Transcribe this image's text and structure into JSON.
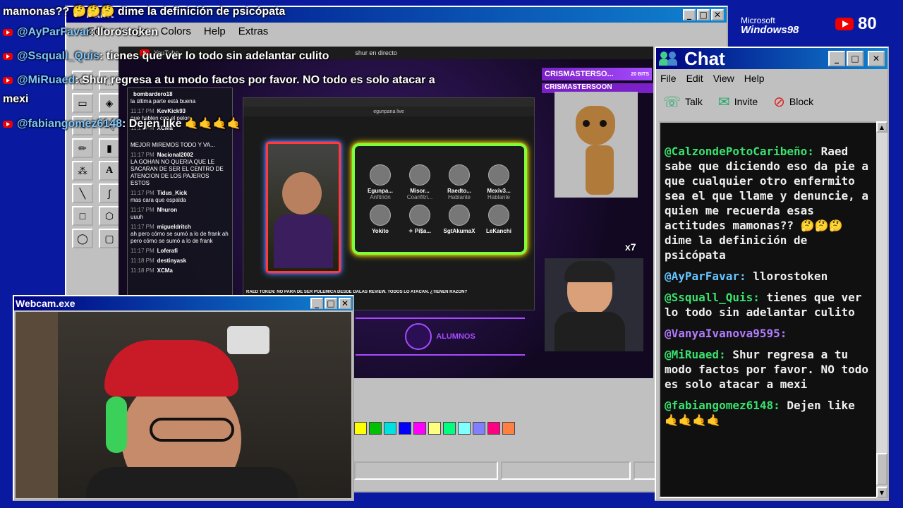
{
  "overlay": {
    "lines": [
      {
        "user": "",
        "text": "mamonas?? 🤔🤔🤔 dime la definición de psicópata"
      },
      {
        "user": "@AyParFavar",
        "text": "llorostoken"
      },
      {
        "user": "@Ssquall_Quis",
        "text": "tienes que ver lo todo sin adelantar culito"
      },
      {
        "user": "@MiRuaed",
        "text": "Shur regresa a tu modo factos por favor. NO todo es solo atacar a"
      },
      {
        "user": "",
        "text": "mexi"
      },
      {
        "user": "@fabiangomez6148",
        "text": "Dejen like 🤙🤙🤙🤙"
      }
    ],
    "yt_count": "80",
    "win_logo_top": "Microsoft",
    "win_logo_bottom": "Windows98"
  },
  "paint": {
    "title": "Paint",
    "menu": [
      "Edit",
      "Image",
      "Colors",
      "Help",
      "Extras"
    ],
    "palette": [
      "#ffff00",
      "#00c000",
      "#00e0e0",
      "#0000ff",
      "#ff00ff",
      "#ffff80",
      "#00ff80",
      "#80ffff",
      "#8080ff",
      "#ff0080",
      "#ff8040"
    ]
  },
  "browser": {
    "tab": "YouTube",
    "search": "shur en directo",
    "ticker": "RAED TOKEN: NO PARA DE SER POLEMICA DESDE DALAS REVIEW. TODOS LO ATACAN. ¿TIENEN RAZON?",
    "inner_search": "egunpana live",
    "side_user1": "CRISMASTERSO...",
    "side_user2": "CRISMASTERSOON",
    "bits": "20 BITS",
    "x7": "x7",
    "alumnos": "ALUMNOS",
    "guests": [
      {
        "name": "Egunpa...",
        "role": "Anfitrión"
      },
      {
        "name": "Misor...",
        "role": "Coanfitri..."
      },
      {
        "name": "Raedto...",
        "role": "Hablante"
      },
      {
        "name": "Mexiv3...",
        "role": "Hablante"
      },
      {
        "name": "Yokito",
        "role": ""
      },
      {
        "name": "✧ Pi$a...",
        "role": ""
      },
      {
        "name": "SgtAkumaX",
        "role": ""
      },
      {
        "name": "LeKanchi",
        "role": ""
      }
    ]
  },
  "side_chat": [
    {
      "time": "",
      "user": "bombardero18",
      "msg": "la última parte está buena"
    },
    {
      "time": "11:17 PM",
      "user": "KevKick93",
      "msg": "que hablen con el pelon"
    },
    {
      "time": "11:17 PM",
      "user": "XCMa",
      "msg": ""
    },
    {
      "time": "",
      "user": "",
      "msg": "MEJOR MIREMOS TODO Y VA..."
    },
    {
      "time": "11:17 PM",
      "user": "Nacional2002",
      "msg": "LA GOHAN NO QUERIA QUE LE SACARAN DE SER EL CENTRO DE ATENCION DE LOS PAJEROS ESTOS"
    },
    {
      "time": "11:17 PM",
      "user": "Tidus_Kick",
      "msg": "mas cara que espalda"
    },
    {
      "time": "11:17 PM",
      "user": "Nhuron",
      "msg": "uuuh"
    },
    {
      "time": "11:17 PM",
      "user": "migueldritch",
      "msg": "ah pero cómo se sumó a lo de frank ah pero cómo se sumó a lo de frank"
    },
    {
      "time": "11:17 PM",
      "user": "Loferafi",
      "msg": ""
    },
    {
      "time": "11:18 PM",
      "user": "destinyask",
      "msg": ""
    },
    {
      "time": "11:18 PM",
      "user": "XCMa",
      "msg": ""
    }
  ],
  "webcam": {
    "title": "Webcam.exe"
  },
  "chat": {
    "title": "Chat",
    "menu": [
      "File",
      "Edit",
      "View",
      "Help"
    ],
    "tools": [
      "Talk",
      "Invite",
      "Block"
    ],
    "messages": [
      {
        "user": "@CalzondePotoCaribeño:",
        "text": "Raed sabe que diciendo eso da pie a que cualquier otro enfermito sea el que llame y denuncie, a quien me recuerda esas actitudes mamonas?? 🤔🤔🤔 dime la definición de psicópata",
        "c": "u"
      },
      {
        "user": "@AyParFavar:",
        "text": "llorostoken",
        "c": "u3"
      },
      {
        "user": "@Ssquall_Quis:",
        "text": "tienes que ver lo todo sin adelantar culito",
        "c": "u"
      },
      {
        "user": "@VanyaIvanova9595:",
        "text": "",
        "c": "u2"
      },
      {
        "user": "@MiRuaed:",
        "text": "Shur regresa a tu modo factos por favor. NO todo es solo atacar a mexi",
        "c": "u"
      },
      {
        "user": "@fabiangomez6148:",
        "text": "Dejen like 🤙🤙🤙🤙",
        "c": "u"
      }
    ]
  }
}
